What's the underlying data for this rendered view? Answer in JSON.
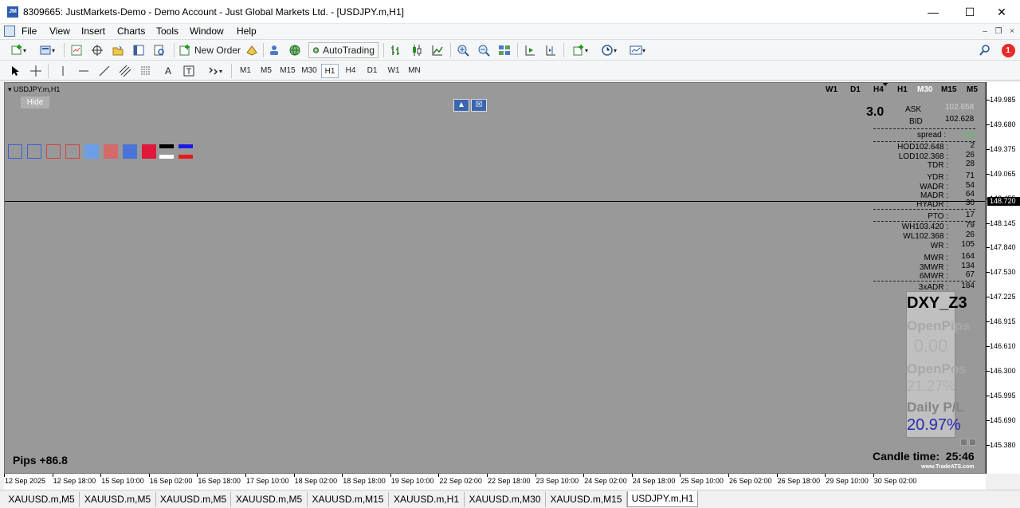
{
  "window": {
    "icon_text": "JM",
    "title": "8309665: JustMarkets-Demo - Demo Account - Just Global Markets Ltd. - [USDJPY.m,H1]",
    "minimize": "—",
    "maximize": "☐",
    "close": "✕"
  },
  "menu": {
    "items": [
      "File",
      "View",
      "Insert",
      "Charts",
      "Tools",
      "Window",
      "Help"
    ],
    "mdi": {
      "minimize": "–",
      "restore": "❐",
      "close": "×"
    }
  },
  "toolbar": {
    "new_order": "New Order",
    "auto_trading": "AutoTrading",
    "search_icon": "search-icon",
    "notification_count": "1"
  },
  "timeframes": [
    "M1",
    "M5",
    "M15",
    "M30",
    "H1",
    "H4",
    "D1",
    "W1",
    "MN"
  ],
  "active_timeframe": "H1",
  "chart": {
    "symbol_label": "USDJPY.m,H1",
    "hide_label": "Hide",
    "background": "#999999",
    "swatches": [
      "#3a5fcd",
      "#3a5fcd",
      "#d04545",
      "#d04545",
      "#6c9ee8",
      "#d46a6a",
      "#4a74d8",
      "#e0183c"
    ],
    "tf_right": [
      "W1",
      "D1",
      "H4",
      "H1",
      "M30",
      "M15",
      "M5"
    ],
    "tf_right_active": "M30",
    "spread_big": "3.0",
    "ask_label": "ASK",
    "ask_value": "102.658",
    "bid_label": "BID",
    "bid_value": "102.628",
    "spread_label": "spread :",
    "spread_value": "3.0",
    "stats": [
      {
        "label": "HOD102.648 :",
        "value": "2"
      },
      {
        "label": "LOD102.368 :",
        "value": "26"
      },
      {
        "label": "TDR :",
        "value": "28"
      },
      {
        "label": "YDR :",
        "value": "71"
      },
      {
        "label": "WADR :",
        "value": "54"
      },
      {
        "label": "MADR :",
        "value": "64"
      },
      {
        "label": "HYADR :",
        "value": "30"
      },
      {
        "label": "PTO :",
        "value": "17"
      },
      {
        "label": "WH103.420 :",
        "value": "79"
      },
      {
        "label": "WL102.368 :",
        "value": "26"
      },
      {
        "label": "WR :",
        "value": "105"
      },
      {
        "label": "MWR :",
        "value": "164"
      },
      {
        "label": "3MWR :",
        "value": "134"
      },
      {
        "label": "6MWR :",
        "value": "67"
      },
      {
        "label": "3xADR :",
        "value": "184"
      }
    ],
    "dxy_title": "DXY_Z3",
    "open_pips_label": "OpenPips",
    "open_pips_value": "0.00",
    "open_pos_label": "OpenPos",
    "open_pos_value": "21.27%",
    "daily_pl_label": "Daily P/L",
    "daily_pl_value": "20.97%",
    "pips_text": "Pips +86.8",
    "candle_time_label": "Candle time:",
    "candle_time_value": "25:46",
    "brand": "www.TradeATS.com"
  },
  "price_axis": {
    "labels": [
      "149.985",
      "149.680",
      "149.375",
      "149.065",
      "148.455",
      "148.145",
      "147.840",
      "147.530",
      "147.225",
      "146.915",
      "146.610",
      "146.300",
      "145.995",
      "145.690",
      "145.380"
    ],
    "current": "148.720"
  },
  "time_axis": {
    "labels": [
      "12 Sep 2025",
      "12 Sep 18:00",
      "15 Sep 10:00",
      "16 Sep 02:00",
      "16 Sep 18:00",
      "17 Sep 10:00",
      "18 Sep 02:00",
      "18 Sep 18:00",
      "19 Sep 10:00",
      "22 Sep 02:00",
      "22 Sep 18:00",
      "23 Sep 10:00",
      "24 Sep 02:00",
      "24 Sep 18:00",
      "25 Sep 10:00",
      "26 Sep 02:00",
      "26 Sep 18:00",
      "29 Sep 10:00",
      "30 Sep 02:00"
    ]
  },
  "tabs": [
    "XAUUSD.m,M5",
    "XAUUSD.m,M5",
    "XAUUSD.m,M5",
    "XAUUSD.m,M5",
    "XAUUSD.m,M15",
    "XAUUSD.m,H1",
    "XAUUSD.m,M30",
    "XAUUSD.m,M15",
    "USDJPY.m,H1"
  ],
  "active_tab": "USDJPY.m,H1"
}
